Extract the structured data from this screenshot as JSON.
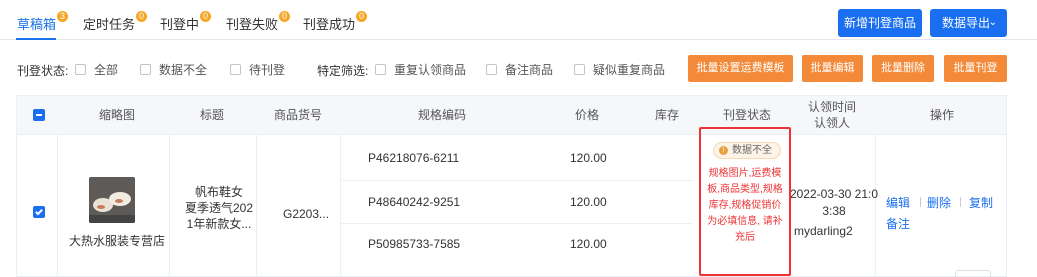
{
  "tabs": [
    {
      "label": "草稿箱",
      "count": "3"
    },
    {
      "label": "定时任务",
      "count": "0"
    },
    {
      "label": "刊登中",
      "count": "0"
    },
    {
      "label": "刊登失败",
      "count": "0"
    },
    {
      "label": "刊登成功",
      "count": "0"
    }
  ],
  "header_buttons": {
    "new": "新增刊登商品",
    "export": "数据导出"
  },
  "filters": {
    "status_label": "刊登状态:",
    "status_options": [
      "全部",
      "数据不全",
      "待刊登"
    ],
    "special_label": "特定筛选:",
    "special_options": [
      "重复认领商品",
      "备注商品",
      "疑似重复商品"
    ]
  },
  "bulk_buttons": [
    "批量设置运费模板",
    "批量编辑",
    "批量删除",
    "批量刊登"
  ],
  "table": {
    "headers": {
      "thumb": "缩略图",
      "title": "标题",
      "sku": "商品货号",
      "spec": "规格编码",
      "price": "价格",
      "stock": "库存",
      "status": "刊登状态",
      "claim_time": "认领时间",
      "claimer": "认领人",
      "actions": "操作"
    },
    "row": {
      "shop": "大热水服装专营店",
      "title_lines": [
        "帆布鞋女",
        "夏季透气202",
        "1年新款女..."
      ],
      "sku": "G2203...",
      "variants": [
        {
          "spec": "P46218076-6211",
          "price": "120.00"
        },
        {
          "spec": "P48640242-9251",
          "price": "120.00"
        },
        {
          "spec": "P50985733-7585",
          "price": "120.00"
        }
      ],
      "status_tag": "数据不全",
      "status_msg": "规格图片,运费模板,商品类型,规格库存,规格促销价为必填信息, 请补充后",
      "claim_time_lines": [
        "2022-03-30 21:0",
        "3:38"
      ],
      "claimer": "mydarling2",
      "actions": {
        "edit": "编辑",
        "delete": "删除",
        "copy": "复制",
        "note": "备注"
      }
    }
  },
  "colors": {
    "primary": "#1a6ff0",
    "orange": "#f28a3a",
    "badge": "#f5a623",
    "error": "#ee3333"
  }
}
